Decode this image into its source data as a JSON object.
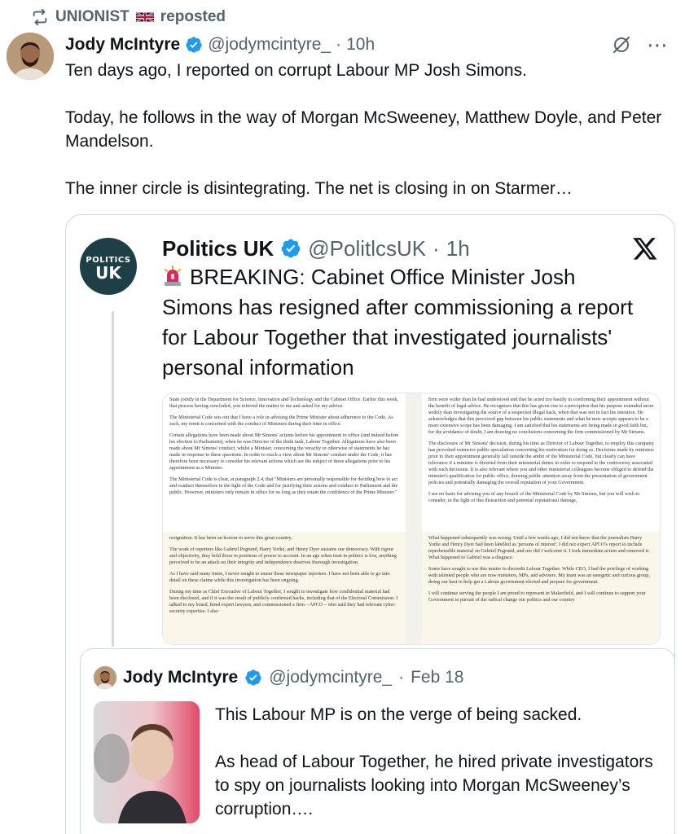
{
  "repost": {
    "user": "UNIONIST",
    "action": "reposted"
  },
  "post": {
    "author_name": "Jody McIntyre",
    "handle": "@jodymcintyre_",
    "time": "10h",
    "paragraphs": [
      "Ten days ago, I reported on corrupt Labour MP Josh Simons.",
      "Today, he follows in the way of Morgan McSweeney, Matthew Doyle, and Peter Mandelson.",
      "The inner circle is disintegrating. The net is closing in on Starmer…"
    ]
  },
  "quoted": {
    "author_name": "Politics UK",
    "handle": "@PolitlcsUK",
    "time": "1h",
    "avatar_line1": "POLITICS",
    "avatar_line2": "UK",
    "text": "BREAKING: Cabinet Office Minister Josh Simons has resigned after commissioning a report for Labour Together that investigated journalists' personal information",
    "document": {
      "top_left": [
        "State jointly in the Department for Science, Innovation and Technology and the Cabinet Office. Earlier this week, that process having concluded, you referred the matter to me and asked for my advice.",
        "The Ministerial Code sets out that I have a role in advising the Prime Minister about adherence to the Code. As such, my remit is concerned with the conduct of Ministers during their time in office.",
        "Certain allegations have been made about Mr Simons' actions before his appointment to office (and indeed before his election to Parliament), when he was Director of the think tank, Labour Together. Allegations have also been made about Mr Simons' conduct, whilst a Minister, concerning the veracity or otherwise of statements he has made in response to these questions. In order to reach a view about Mr Simons' conduct under the Code, it has therefore been necessary to consider his relevant actions which are the subject of these allegations prior to his appointment as a Minister.",
        "The Ministerial Code is clear, at paragraph 2.4, that \"Ministers are personally responsible for deciding how to act and conduct themselves in the light of the Code and for justifying their actions and conduct to Parliament and the public. However, ministers only remain in office for so long as they retain the confidence of the Prime Minister.\""
      ],
      "top_right": [
        "firm were wider than he had understood and that he acted too hastily in confirming their appointment without the benefit of legal advice. He recognises that this has given rise to a perception that his purpose extended more widely than investigating the source of a suspected illegal hack, when that was not in fact his intention. He acknowledges that this perceived gap between his public statements and what he now accepts appears to be a more extensive scope has been damaging. I am satisfied that his statements are being made in good faith but, for the avoidance of doubt, I am drawing no conclusions concerning the firm commissioned by Mr Simons.",
        "The disclosure of Mr Simons' decision, during his time as Director of Labour Together, to employ this company has provoked extensive public speculation concerning his motivation for doing so. Decisions made by ministers prior to their appointment generally fall outside the ambit of the Ministerial Code, but clearly can have relevance if a minister is diverted from their ministerial duties in order to respond to the controversy associated with such decisions. It is also relevant where you and other ministerial colleagues become obliged to defend the minister's qualification for public office, drawing public attention away from the presentation of government policies and potentially damaging the overall reputation of your Government.",
        "I see no basis for advising you of any breach of the Ministerial Code by Mr Simons, but you will wish to consider, in the light of this distraction and potential reputational damage,"
      ],
      "bottom_left": [
        "resignation. It has been an honour to serve this great country.",
        "The work of reporters like Gabriel Pogrund, Harry Yorke, and Henry Dyer sustains our democracy. With rigour and objectivity, they hold those in positions of power to account. In an age when trust in politics is low, anything perceived to be an attack on their integrity and independence deserves thorough investigation.",
        "As I have said many times, I never sought to smear these newspaper reporters. I have not been able to go into detail on these claims while this investigation has been ongoing.",
        "During my time as Chief Executive of Labour Together, I sought to investigate how confidential material had been disclosed, and if it was the result of publicly confirmed hacks, including that of the Electoral Commission. I talked to my board, hired expert lawyers, and commissioned a firm – APCO – who said they had relevant cyber-security expertise. I also"
      ],
      "bottom_right": [
        "What happened subsequently was wrong. Until a few weeks ago, I did not know that the journalists Harry Yorke and Henry Dyer had been labelled as 'persons of interest'. I did not expect APCO's report to include reprehensible material on Gabriel Pogrund, and nor did I welcome it. I took immediate action and removed it. What happened to Gabriel was a disgrace.",
        "Some have sought to use this matter to discredit Labour Together. While CEO, I had the privilege of working with talented people who are now ministers, MPs, and advisers. My team was an energetic and curious group, doing our best to help get a Labour government elected and prepare for government.",
        "I will continue serving the people I am proud to represent in Makerfield, and I will continue to support your Government in pursuit of the radical change our politics and our country"
      ]
    }
  },
  "inner_quote": {
    "author_name": "Jody McIntyre",
    "handle": "@jodymcintyre_",
    "time": "Feb 18",
    "paragraphs": [
      "This Labour MP is on the verge of being sacked.",
      "As head of Labour Together, he hired private investigators to spy on journalists looking into Morgan McSweeney’s corruption…."
    ]
  },
  "icons": {
    "repost": "repost-icon",
    "flag": "uk-flag-icon",
    "verified": "verified-badge-icon",
    "grok": "grok-icon",
    "more": "more-icon",
    "x_logo": "x-logo-icon",
    "siren": "siren-emoji-icon"
  },
  "colors": {
    "text": "#0f1419",
    "secondary": "#536471",
    "verified": "#1d9bf0",
    "border": "#cfd9de",
    "avatar_politics": "#1f3f46"
  }
}
